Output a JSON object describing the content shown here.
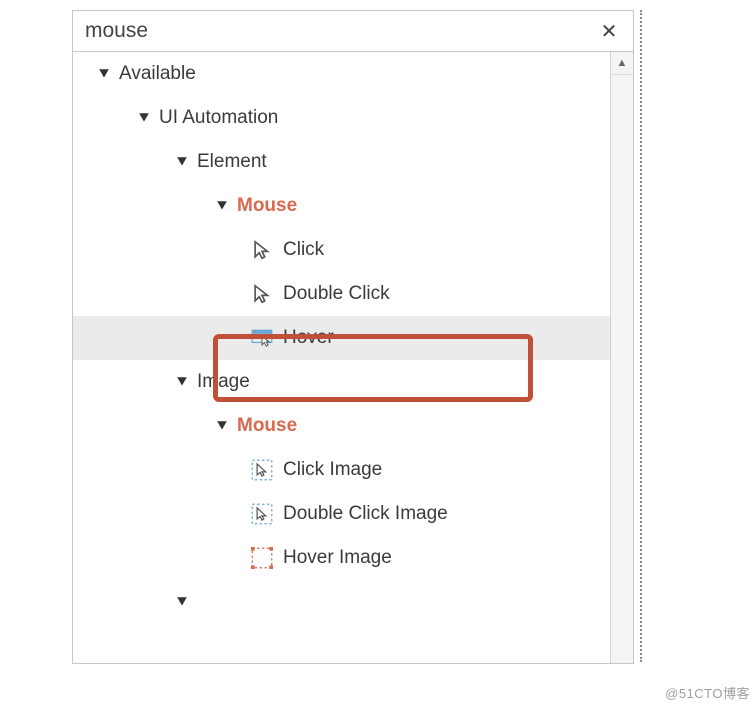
{
  "search": {
    "value": "mouse",
    "clear_symbol": "✕"
  },
  "tree": {
    "root": "Available",
    "branch": "UI Automation",
    "group1": {
      "label": "Element",
      "match": "Mouse",
      "items": [
        "Click",
        "Double Click",
        "Hover"
      ],
      "selected": "Hover"
    },
    "group2": {
      "label": "Image",
      "match": "Mouse",
      "items": [
        "Click Image",
        "Double Click Image",
        "Hover Image"
      ]
    }
  },
  "watermark": "@51CTO博客"
}
